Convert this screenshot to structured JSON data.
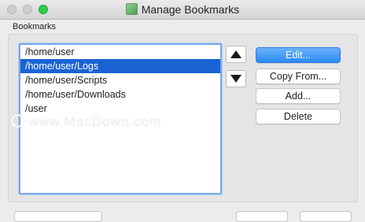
{
  "window": {
    "title": "Manage Bookmarks"
  },
  "group": {
    "label": "Bookmarks"
  },
  "bookmarks": {
    "items": [
      "/home/user",
      "/home/user/Logs",
      "/home/user/Scripts",
      "/home/user/Downloads",
      "/user"
    ],
    "selected": "/home/user/Logs"
  },
  "buttons": {
    "edit": "Edit...",
    "copy_from": "Copy From...",
    "add": "Add...",
    "delete": "Delete"
  },
  "watermark": {
    "text": "www.MacDown.com"
  },
  "colors": {
    "selection": "#1b63d4",
    "primary_button": "#2a8af6",
    "zoom_button": "#2ecc48"
  }
}
